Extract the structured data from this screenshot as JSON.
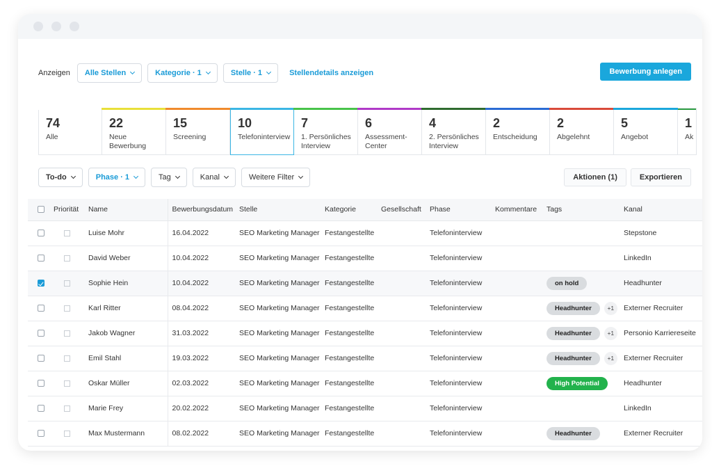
{
  "filterbar": {
    "show_label": "Anzeigen",
    "stellen": "Alle Stellen",
    "kategorie": "Kategorie · 1",
    "stelle": "Stelle · 1",
    "details_link": "Stellendetails anzeigen",
    "primary_button": "Bewerbung anlegen"
  },
  "stages": [
    {
      "count": "74",
      "label": "Alle",
      "color": "#ffffff"
    },
    {
      "count": "22",
      "label": "Neue Bewerbung",
      "color": "#e8e03a"
    },
    {
      "count": "15",
      "label": "Screening",
      "color": "#f08a2c"
    },
    {
      "count": "10",
      "label": "Telefoninterview",
      "color": "#3bb6e4"
    },
    {
      "count": "7",
      "label": "1. Persönliches Interview",
      "color": "#48c34a"
    },
    {
      "count": "6",
      "label": "Assessment-Center",
      "color": "#b03ac8"
    },
    {
      "count": "4",
      "label": "2. Persönliches Interview",
      "color": "#2f6b2f"
    },
    {
      "count": "2",
      "label": "Entscheidung",
      "color": "#2a6bd4"
    },
    {
      "count": "2",
      "label": "Abgelehnt",
      "color": "#d94a3a"
    },
    {
      "count": "5",
      "label": "Angebot",
      "color": "#1aa7dc"
    },
    {
      "count": "1",
      "label": "Ak",
      "color": "#2f9e44"
    }
  ],
  "filters2": {
    "todo": "To-do",
    "phase": "Phase · 1",
    "tag": "Tag",
    "kanal": "Kanal",
    "weitere": "Weitere Filter",
    "aktionen": "Aktionen (1)",
    "exportieren": "Exportieren"
  },
  "table": {
    "headers": {
      "prioritaet": "Priorität",
      "name": "Name",
      "datum": "Bewerbungsdatum",
      "stelle": "Stelle",
      "kategorie": "Kategorie",
      "gesellschaft": "Gesellschaft",
      "phase": "Phase",
      "kommentare": "Kommentare",
      "tags": "Tags",
      "kanal": "Kanal"
    },
    "rows": [
      {
        "name": "Luise Mohr",
        "date": "16.04.2022",
        "stelle": "SEO Marketing Manager",
        "kategorie": "Festangestellte",
        "phase": "Telefoninterview",
        "tag": "",
        "plus": "",
        "kanal": "Stepstone"
      },
      {
        "name": "David Weber",
        "date": "10.04.2022",
        "stelle": "SEO Marketing Manager",
        "kategorie": "Festangestellte",
        "phase": "Telefoninterview",
        "tag": "",
        "plus": "",
        "kanal": "LinkedIn"
      },
      {
        "name": "Sophie Hein",
        "date": "10.04.2022",
        "stelle": "SEO Marketing Manager",
        "kategorie": "Festangestellte",
        "phase": "Telefoninterview",
        "tag": "on hold",
        "plus": "",
        "kanal": "Headhunter"
      },
      {
        "name": "Karl Ritter",
        "date": "08.04.2022",
        "stelle": "SEO Marketing Manager",
        "kategorie": "Festangestellte",
        "phase": "Telefoninterview",
        "tag": "Headhunter",
        "plus": "+1",
        "kanal": "Externer Recruiter"
      },
      {
        "name": "Jakob Wagner",
        "date": "31.03.2022",
        "stelle": "SEO Marketing Manager",
        "kategorie": "Festangestellte",
        "phase": "Telefoninterview",
        "tag": "Headhunter",
        "plus": "+1",
        "kanal": "Personio Karriereseite"
      },
      {
        "name": "Emil Stahl",
        "date": "19.03.2022",
        "stelle": "SEO Marketing Manager",
        "kategorie": "Festangestellte",
        "phase": "Telefoninterview",
        "tag": "Headhunter",
        "plus": "+1",
        "kanal": "Externer Recruiter"
      },
      {
        "name": "Oskar Müller",
        "date": "02.03.2022",
        "stelle": "SEO Marketing Manager",
        "kategorie": "Festangestellte",
        "phase": "Telefoninterview",
        "tag": "High Potential",
        "plus": "",
        "kanal": "Headhunter"
      },
      {
        "name": "Marie Frey",
        "date": "20.02.2022",
        "stelle": "SEO Marketing Manager",
        "kategorie": "Festangestellte",
        "phase": "Telefoninterview",
        "tag": "",
        "plus": "",
        "kanal": "LinkedIn"
      },
      {
        "name": "Max Mustermann",
        "date": "08.02.2022",
        "stelle": "SEO Marketing Manager",
        "kategorie": "Festangestellte",
        "phase": "Telefoninterview",
        "tag": "Headhunter",
        "plus": "",
        "kanal": "Externer Recruiter"
      }
    ]
  }
}
